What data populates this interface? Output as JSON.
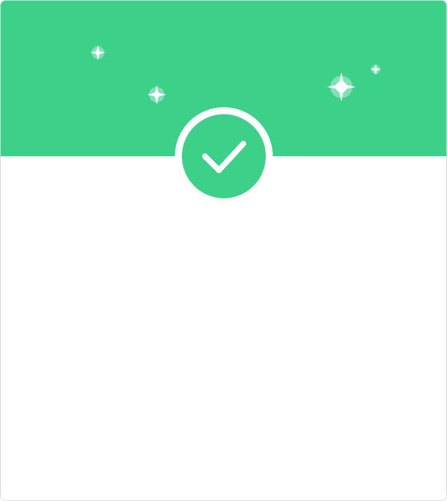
{
  "theme": {
    "accent": "#3ecf8b",
    "surface": "#ffffff",
    "border": "#d9d9d9",
    "check_color": "#ffffff"
  },
  "success_card": {
    "icon": "checkmark-icon",
    "decorations": [
      "sparkle-icon",
      "sparkle-icon",
      "sparkle-icon",
      "sparkle-icon",
      "sparkle-icon"
    ],
    "body_text": ""
  }
}
